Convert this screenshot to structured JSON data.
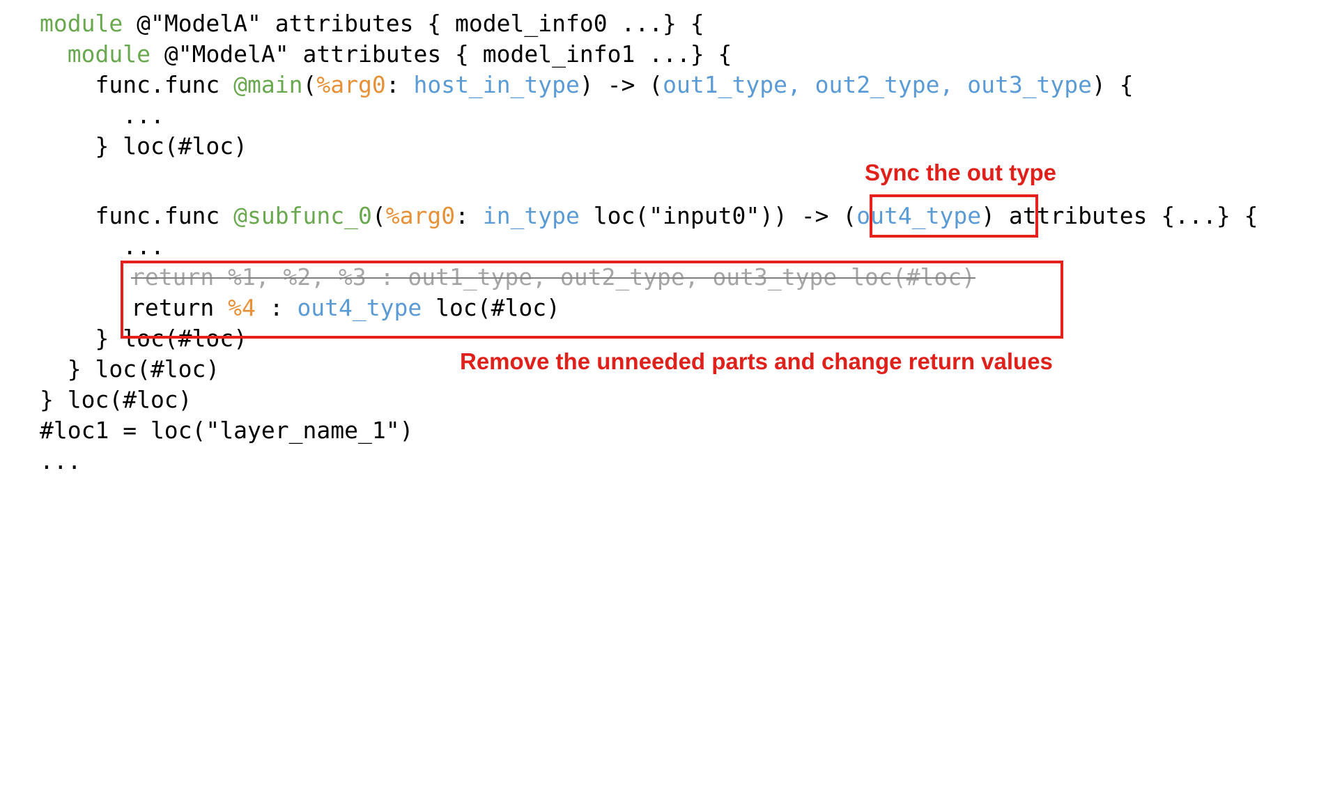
{
  "code": {
    "l1": {
      "kw": "module",
      "text": " @\"ModelA\" attributes { model_info0 ...} {"
    },
    "l2": {
      "indent": "  ",
      "kw": "module",
      "text": " @\"ModelA\" attributes { model_info1 ...} {"
    },
    "l3": {
      "indent": "    ",
      "a": "func.func ",
      "fn": "@main",
      "b": "(",
      "arg": "%arg0",
      "c": ": ",
      "ty": "host_in_type",
      "d": ") -> (",
      "outs": "out1_type, out2_type, out3_type",
      "e": ") {"
    },
    "l4": "      ...",
    "l5": "    } loc(#loc)",
    "l6": {
      "indent": "    ",
      "a": "func.func ",
      "fn": "@subfunc_0",
      "b": "(",
      "arg": "%arg0",
      "c": ": ",
      "ty": "in_type",
      "d": " loc(\"input0\")) -> ",
      "out_open": "(",
      "out": "out4_type",
      "out_close": ")",
      "e": " attributes {...} {"
    },
    "l7": "      ...",
    "l8": "return %1, %2, %3 : out1_type, out2_type, out3_type loc(#loc)",
    "l9": {
      "a": "return ",
      "val": "%4",
      "b": " : ",
      "ty": "out4_type",
      "c": " loc(#loc)"
    },
    "l10": "    } loc(#loc)",
    "l11": "  } loc(#loc)",
    "l12": "} loc(#loc)",
    "l13": "#loc1 = loc(\"layer_name_1\")",
    "l14": "..."
  },
  "annotations": {
    "sync": "Sync the out type",
    "remove": "Remove the unneeded parts and change return values"
  },
  "colors": {
    "keyword": "#6aa84f",
    "argument": "#e69138",
    "type": "#5b9bd5",
    "annotation": "#e0201b"
  }
}
